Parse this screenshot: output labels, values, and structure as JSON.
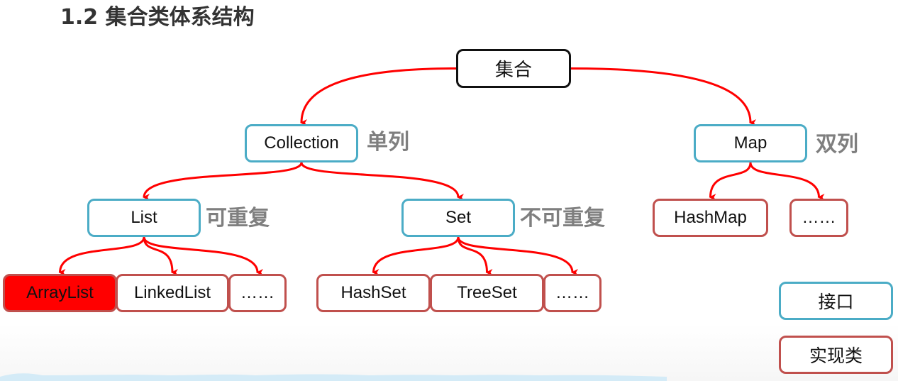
{
  "title": "1.2 集合类体系结构",
  "colors": {
    "edge": "#ff0000",
    "interface_border": "#4bacc6",
    "implementation_border": "#c0504d",
    "root_border": "#111111",
    "highlight_fill": "#ff0000",
    "note_text": "#7f7f7f"
  },
  "nodes": {
    "root": "集合",
    "collection": "Collection",
    "map": "Map",
    "list": "List",
    "set": "Set",
    "arraylist": "ArrayList",
    "linkedlist": "LinkedList",
    "list_more": "……",
    "hashset": "HashSet",
    "treeset": "TreeSet",
    "set_more": "……",
    "hashmap": "HashMap",
    "map_more": "……"
  },
  "notes": {
    "collection": "单列",
    "map": "双列",
    "list": "可重复",
    "set": "不可重复"
  },
  "legend": {
    "interface": "接口",
    "implementation": "实现类"
  },
  "edges": [
    {
      "from": "root",
      "to": "collection"
    },
    {
      "from": "root",
      "to": "map"
    },
    {
      "from": "collection",
      "to": "list"
    },
    {
      "from": "collection",
      "to": "set"
    },
    {
      "from": "list",
      "to": "arraylist"
    },
    {
      "from": "list",
      "to": "linkedlist"
    },
    {
      "from": "list",
      "to": "list_more"
    },
    {
      "from": "set",
      "to": "hashset"
    },
    {
      "from": "set",
      "to": "treeset"
    },
    {
      "from": "set",
      "to": "set_more"
    },
    {
      "from": "map",
      "to": "hashmap"
    },
    {
      "from": "map",
      "to": "map_more"
    }
  ],
  "highlighted": "arraylist"
}
